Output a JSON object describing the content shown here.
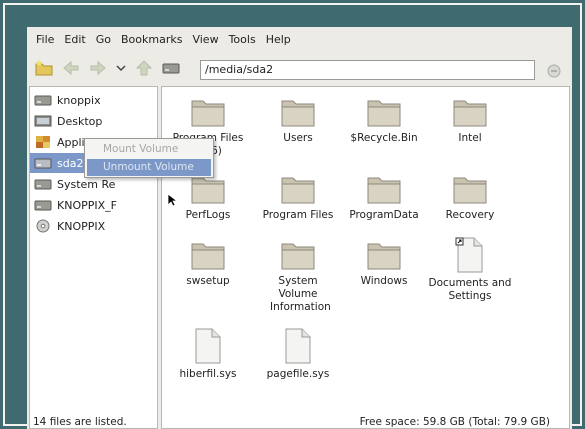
{
  "menubar": {
    "items": [
      "File",
      "Edit",
      "Go",
      "Bookmarks",
      "View",
      "Tools",
      "Help"
    ]
  },
  "toolbar": {
    "icons": [
      "new-folder-icon",
      "back-icon",
      "forward-icon",
      "dropdown-icon",
      "up-icon",
      "drive-icon"
    ],
    "location": "/media/sda2"
  },
  "sidebar": {
    "items": [
      {
        "label": "knoppix",
        "icon": "drive-icon"
      },
      {
        "label": "Desktop",
        "icon": "desktop-icon"
      },
      {
        "label": "Applications",
        "icon": "applications-icon"
      },
      {
        "label": "sda2",
        "icon": "drive-icon",
        "selected": true
      },
      {
        "label": "System Re",
        "icon": "drive-icon"
      },
      {
        "label": "KNOPPIX_F",
        "icon": "drive-icon"
      },
      {
        "label": "KNOPPIX",
        "icon": "cdrom-icon"
      }
    ]
  },
  "context_menu": {
    "items": [
      {
        "label": "Mount Volume",
        "disabled": true
      },
      {
        "label": "Unmount Volume",
        "highlighted": true
      }
    ]
  },
  "files": [
    {
      "label": "Program Files (x86)",
      "type": "folder"
    },
    {
      "label": "Users",
      "type": "folder"
    },
    {
      "label": "$Recycle.Bin",
      "type": "folder"
    },
    {
      "label": "Intel",
      "type": "folder"
    },
    {
      "label": "PerfLogs",
      "type": "folder"
    },
    {
      "label": "Program Files",
      "type": "folder"
    },
    {
      "label": "ProgramData",
      "type": "folder"
    },
    {
      "label": "Recovery",
      "type": "folder"
    },
    {
      "label": "swsetup",
      "type": "folder"
    },
    {
      "label": "System Volume Information",
      "type": "folder"
    },
    {
      "label": "Windows",
      "type": "folder"
    },
    {
      "label": "Documents and Settings",
      "type": "link"
    },
    {
      "label": "hiberfil.sys",
      "type": "file"
    },
    {
      "label": "pagefile.sys",
      "type": "file"
    }
  ],
  "status": {
    "left": "14 files are listed.",
    "right": "Free space: 59.8 GB (Total: 79.9 GB)"
  },
  "colors": {
    "background": "#3e6a70",
    "selection": "#7c98c8",
    "folder": "#c9c3b0"
  }
}
